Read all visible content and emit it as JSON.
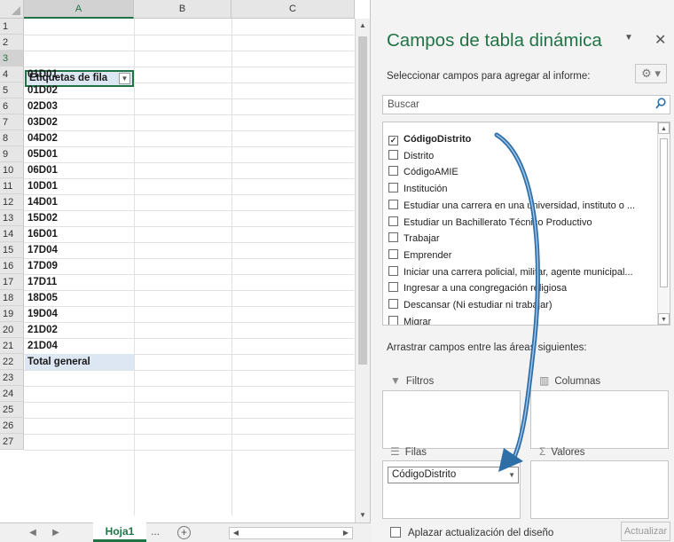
{
  "sheet": {
    "columns": [
      "A",
      "B",
      "C"
    ],
    "row_numbers": [
      "1",
      "2",
      "3",
      "4",
      "5",
      "6",
      "7",
      "8",
      "9",
      "10",
      "11",
      "12",
      "13",
      "14",
      "15",
      "16",
      "17",
      "18",
      "19",
      "20",
      "21",
      "22",
      "23",
      "24",
      "25",
      "26",
      "27"
    ],
    "header_cell": "Etiquetas de fila",
    "dropdown_icon": "filter-dropdown-icon",
    "rows": [
      "01D01",
      "01D02",
      "02D03",
      "03D02",
      "04D02",
      "05D01",
      "06D01",
      "10D01",
      "14D01",
      "15D02",
      "16D01",
      "17D04",
      "17D09",
      "17D11",
      "18D05",
      "19D04",
      "21D02",
      "21D04"
    ],
    "total_label": "Total general",
    "tab_name": "Hoja1",
    "tab_more": "... ",
    "tab_add": "+"
  },
  "pane": {
    "title": "Campos de tabla dinámica",
    "select_label": "Seleccionar campos para agregar al informe:",
    "search_placeholder": "Buscar",
    "fields": [
      {
        "label": "CódigoDistrito",
        "checked": true
      },
      {
        "label": "Distrito",
        "checked": false
      },
      {
        "label": "CódigoAMIE",
        "checked": false
      },
      {
        "label": "Institución",
        "checked": false
      },
      {
        "label": "Estudiar una carrera en una universidad, instituto o ...",
        "checked": false
      },
      {
        "label": "Estudiar un Bachillerato Técnico Productivo",
        "checked": false
      },
      {
        "label": "Trabajar",
        "checked": false
      },
      {
        "label": "Emprender",
        "checked": false
      },
      {
        "label": "Iniciar una carrera policial, militar, agente municipal...",
        "checked": false
      },
      {
        "label": "Ingresar a una congregación religiosa",
        "checked": false
      },
      {
        "label": "Descansar (Ni estudiar ni trabajar)",
        "checked": false
      },
      {
        "label": "Migrar",
        "checked": false
      }
    ],
    "drag_label": "Arrastrar campos entre las áreas siguientes:",
    "areas": {
      "filters": "Filtros",
      "columns": "Columnas",
      "rows": "Filas",
      "values": "Valores"
    },
    "rows_chip": "CódigoDistrito",
    "defer_label": "Aplazar actualización del diseño",
    "update_label": "Actualizar"
  },
  "colors": {
    "accent": "#217346",
    "arrow": "#2f6fa8",
    "selection": "#dde7f3"
  }
}
